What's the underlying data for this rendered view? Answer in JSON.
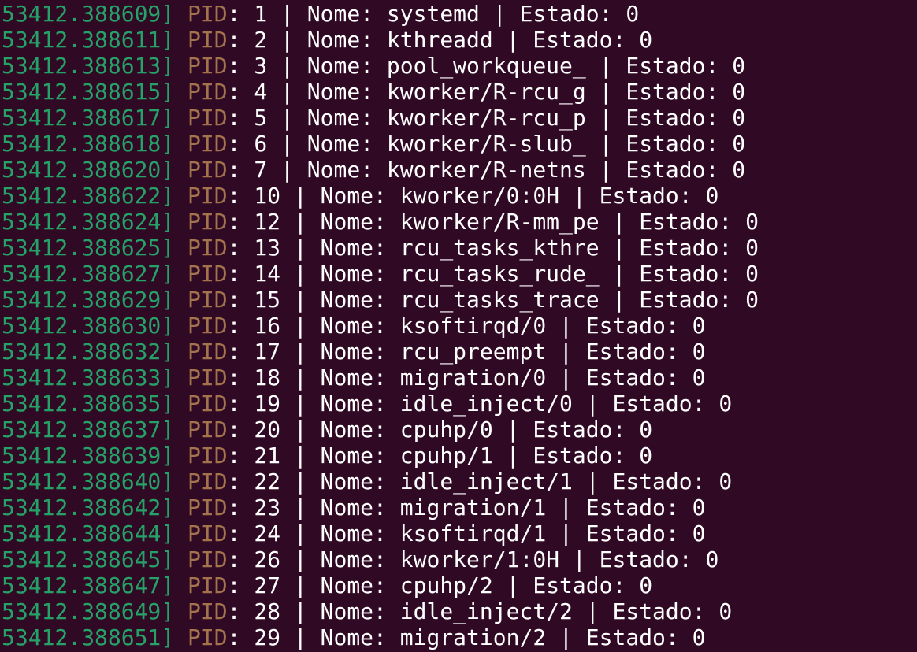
{
  "terminal": {
    "colors": {
      "background": "#300a24",
      "timestamp": "#26a269",
      "pid_label": "#a2734c",
      "text": "#ffffff"
    },
    "pid_label": "PID",
    "lines": [
      {
        "timestamp": "53412.388609]",
        "pid": "1",
        "name": "systemd",
        "state": "0"
      },
      {
        "timestamp": "53412.388611]",
        "pid": "2",
        "name": "kthreadd",
        "state": "0"
      },
      {
        "timestamp": "53412.388613]",
        "pid": "3",
        "name": "pool_workqueue_",
        "state": "0"
      },
      {
        "timestamp": "53412.388615]",
        "pid": "4",
        "name": "kworker/R-rcu_g",
        "state": "0"
      },
      {
        "timestamp": "53412.388617]",
        "pid": "5",
        "name": "kworker/R-rcu_p",
        "state": "0"
      },
      {
        "timestamp": "53412.388618]",
        "pid": "6",
        "name": "kworker/R-slub_",
        "state": "0"
      },
      {
        "timestamp": "53412.388620]",
        "pid": "7",
        "name": "kworker/R-netns",
        "state": "0"
      },
      {
        "timestamp": "53412.388622]",
        "pid": "10",
        "name": "kworker/0:0H",
        "state": "0"
      },
      {
        "timestamp": "53412.388624]",
        "pid": "12",
        "name": "kworker/R-mm_pe",
        "state": "0"
      },
      {
        "timestamp": "53412.388625]",
        "pid": "13",
        "name": "rcu_tasks_kthre",
        "state": "0"
      },
      {
        "timestamp": "53412.388627]",
        "pid": "14",
        "name": "rcu_tasks_rude_",
        "state": "0"
      },
      {
        "timestamp": "53412.388629]",
        "pid": "15",
        "name": "rcu_tasks_trace",
        "state": "0"
      },
      {
        "timestamp": "53412.388630]",
        "pid": "16",
        "name": "ksoftirqd/0",
        "state": "0"
      },
      {
        "timestamp": "53412.388632]",
        "pid": "17",
        "name": "rcu_preempt",
        "state": "0"
      },
      {
        "timestamp": "53412.388633]",
        "pid": "18",
        "name": "migration/0",
        "state": "0"
      },
      {
        "timestamp": "53412.388635]",
        "pid": "19",
        "name": "idle_inject/0",
        "state": "0"
      },
      {
        "timestamp": "53412.388637]",
        "pid": "20",
        "name": "cpuhp/0",
        "state": "0"
      },
      {
        "timestamp": "53412.388639]",
        "pid": "21",
        "name": "cpuhp/1",
        "state": "0"
      },
      {
        "timestamp": "53412.388640]",
        "pid": "22",
        "name": "idle_inject/1",
        "state": "0"
      },
      {
        "timestamp": "53412.388642]",
        "pid": "23",
        "name": "migration/1",
        "state": "0"
      },
      {
        "timestamp": "53412.388644]",
        "pid": "24",
        "name": "ksoftirqd/1",
        "state": "0"
      },
      {
        "timestamp": "53412.388645]",
        "pid": "26",
        "name": "kworker/1:0H",
        "state": "0"
      },
      {
        "timestamp": "53412.388647]",
        "pid": "27",
        "name": "cpuhp/2",
        "state": "0"
      },
      {
        "timestamp": "53412.388649]",
        "pid": "28",
        "name": "idle_inject/2",
        "state": "0"
      },
      {
        "timestamp": "53412.388651]",
        "pid": "29",
        "name": "migration/2",
        "state": "0"
      }
    ]
  }
}
